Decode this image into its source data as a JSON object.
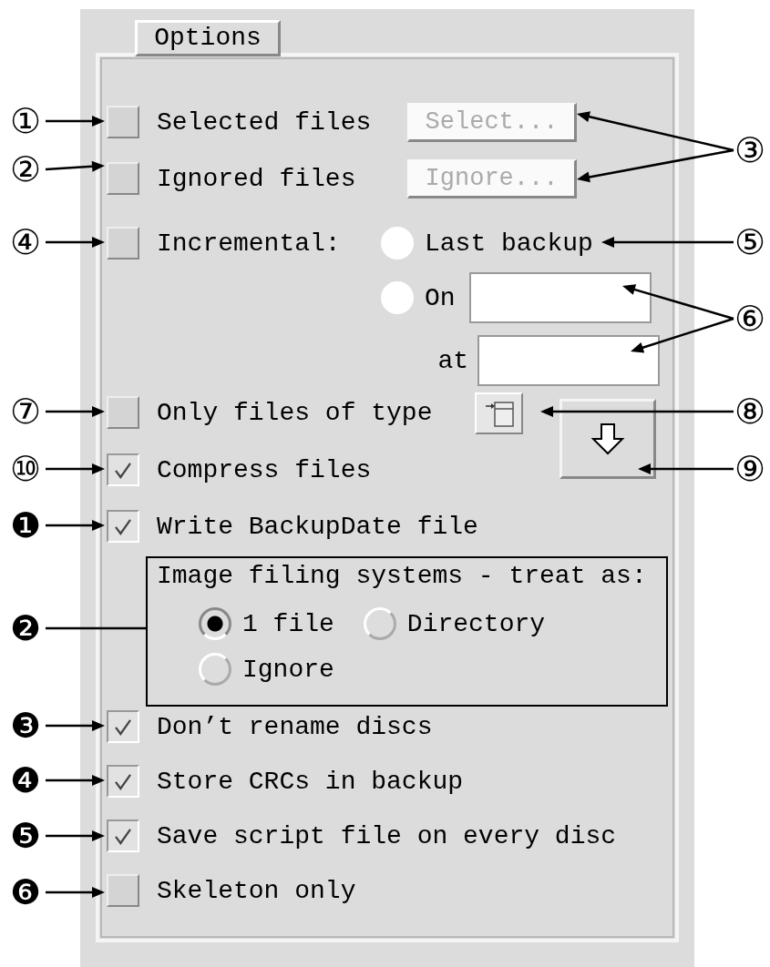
{
  "tab": {
    "label": "Options"
  },
  "checks_top": [
    {
      "label": "Selected files",
      "checked": false,
      "button": {
        "label": "Select...",
        "disabled": true
      }
    },
    {
      "label": "Ignored files",
      "checked": false,
      "button": {
        "label": "Ignore...",
        "disabled": true
      }
    },
    {
      "label": "Incremental:",
      "checked": false
    }
  ],
  "incremental": {
    "last_backup": {
      "label": "Last backup",
      "selected": false
    },
    "on": {
      "label": "On",
      "selected": false
    },
    "time_label": "at"
  },
  "checks_mid": [
    {
      "label": "Only files of type",
      "checked": false
    },
    {
      "label": "Compress files",
      "checked": true
    },
    {
      "label": "Write BackupDate file",
      "checked": true
    }
  ],
  "image_fs": {
    "title": "Image filing systems - treat as:",
    "options": [
      {
        "label": "1 file",
        "selected": true
      },
      {
        "label": "Directory",
        "selected": false
      },
      {
        "label": "Ignore",
        "selected": false
      }
    ]
  },
  "checks_bottom": [
    {
      "label": "Don’t rename discs",
      "checked": true
    },
    {
      "label": "Store CRCs in backup",
      "checked": true
    },
    {
      "label": "Save script file on every disc",
      "checked": true
    },
    {
      "label": "Skeleton only",
      "checked": false
    }
  ],
  "callouts": [
    {
      "label": "①"
    },
    {
      "label": "②"
    },
    {
      "label": "③"
    },
    {
      "label": "④"
    },
    {
      "label": "⑤"
    },
    {
      "label": "⑥"
    },
    {
      "label": "⑦"
    },
    {
      "label": "⑧"
    },
    {
      "label": "⑩"
    },
    {
      "label": "⑨"
    },
    {
      "label": "❶"
    },
    {
      "label": "❷"
    },
    {
      "label": "❸"
    },
    {
      "label": "❹"
    },
    {
      "label": "❺"
    },
    {
      "label": "❻"
    }
  ]
}
